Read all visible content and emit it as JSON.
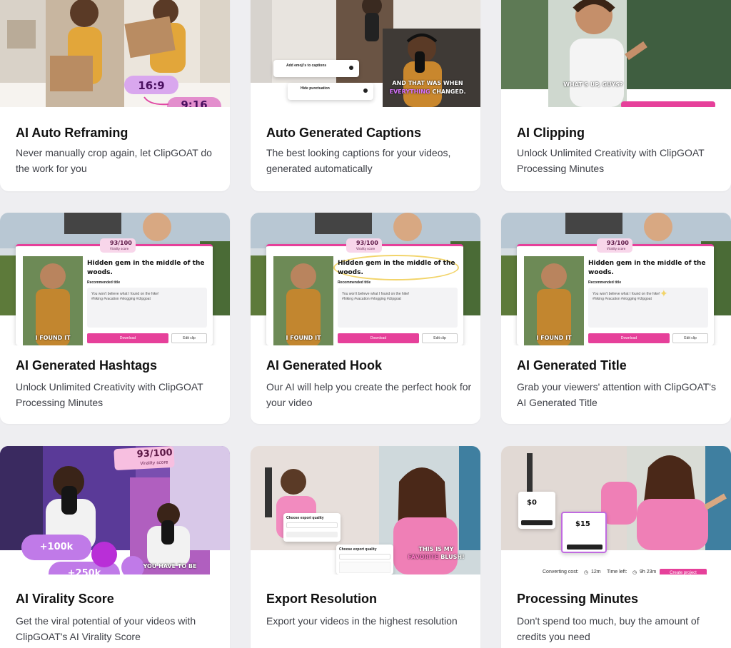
{
  "cards": [
    {
      "title": "AI Auto Reframing",
      "desc": "Never manually crop again, let ClipGOAT do the work for you"
    },
    {
      "title": "Auto Generated Captions",
      "desc": "The best looking captions for your videos, generated automatically"
    },
    {
      "title": "AI Clipping",
      "desc": "Unlock Unlimited Creativity with ClipGOAT Processing Minutes"
    },
    {
      "title": "AI Generated Hashtags",
      "desc": "Unlock Unlimited Creativity with ClipGOAT Processing Minutes"
    },
    {
      "title": "AI Generated Hook",
      "desc": "Our AI will help you create the perfect hook for your video"
    },
    {
      "title": "AI Generated Title",
      "desc": "Grab your viewers' attention with ClipGOAT's AI Generated Title"
    },
    {
      "title": "AI Virality Score",
      "desc": "Get the viral potential of your videos with ClipGOAT's AI Virality Score"
    },
    {
      "title": "Export Resolution",
      "desc": "Export your videos in the highest resolution"
    },
    {
      "title": "Processing Minutes",
      "desc": "Don't spend too much, buy the amount of credits you need"
    }
  ],
  "thumbs": {
    "reframing": {
      "ratio_a": "16:9",
      "ratio_b": "9:16"
    },
    "captions": {
      "opt1": "Add emoji's to captions",
      "opt2": "Hide punctuation",
      "caption_line1": "AND THAT WAS WHEN",
      "caption_word": "EVERYTHING",
      "caption_rest": "CHANGED."
    },
    "clipping": {
      "caption": "WHAT'S UP, GUYS?"
    },
    "panel": {
      "score": "93/100",
      "score_label": "Virality score",
      "title": "Hidden gem in the middle of the woods.",
      "rec_label": "Recommended title",
      "text_line1": "You won't believe what I found on the hike!",
      "text_line2": "#hiking #vacation #vlogging #clipgoat",
      "download": "Download",
      "edit": "Edit clip",
      "subtitle_found": "I FOUND IT"
    },
    "virality": {
      "score": "93/100",
      "score_label": "Virality score",
      "views_a": "+100k",
      "views_b": "+250k",
      "caption": "YOU HAVE TO BE"
    },
    "export": {
      "q1": "Choose export quality",
      "q2": "Choose export quality",
      "caption": "THIS IS MY",
      "caption_word": "FAVORITE",
      "caption_rest": "BLUSH!"
    },
    "minutes": {
      "plan_a_price": "$0",
      "plan_b_price": "$15",
      "conv_label": "Converting cost:",
      "conv_value": "12m",
      "time_label": "Time left:",
      "time_value": "9h 23m",
      "create": "Create project"
    }
  }
}
